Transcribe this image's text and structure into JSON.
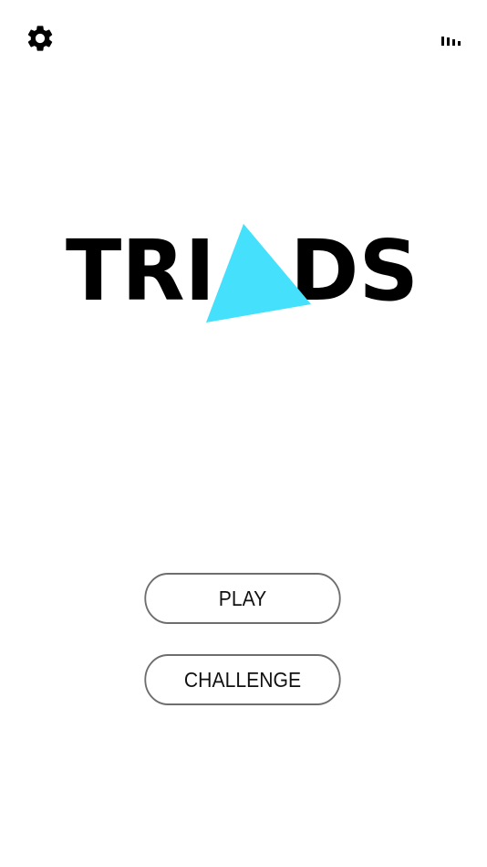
{
  "header": {
    "settings_icon": "gear-icon",
    "leaderboard_icon": "bar-chart-icon"
  },
  "logo": {
    "text": "TRIADS",
    "left": "TRI",
    "right": "DS",
    "accent_color": "#45E0FC"
  },
  "menu": {
    "play_label": "PLAY",
    "challenge_label": "CHALLENGE"
  }
}
